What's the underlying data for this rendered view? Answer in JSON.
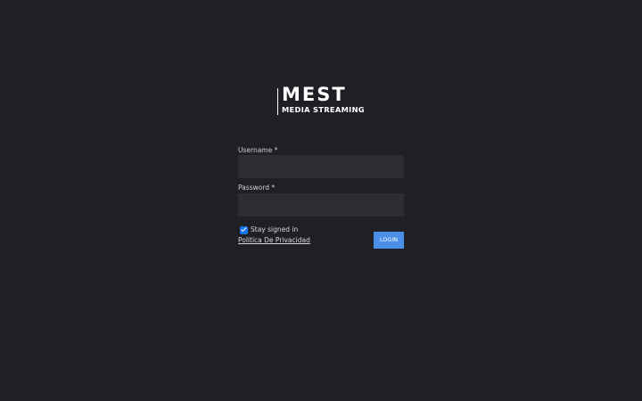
{
  "logo": {
    "main_text": "MEST",
    "sub_text": "MEDIA STREAMING"
  },
  "form": {
    "username": {
      "label": "Username *",
      "value": "",
      "placeholder": ""
    },
    "password": {
      "label": "Password *",
      "value": "",
      "placeholder": ""
    },
    "stay_signed_in": {
      "label": "Stay signed in",
      "checked": true
    },
    "privacy_link": "Politica De Privacidad",
    "login_label": "LOGIN"
  },
  "colors": {
    "background": "#1f2026",
    "input_background": "#2d2e32",
    "accent": "#4a8fe8",
    "checkbox": "#1a73e8",
    "text": "#d8d8d8"
  }
}
